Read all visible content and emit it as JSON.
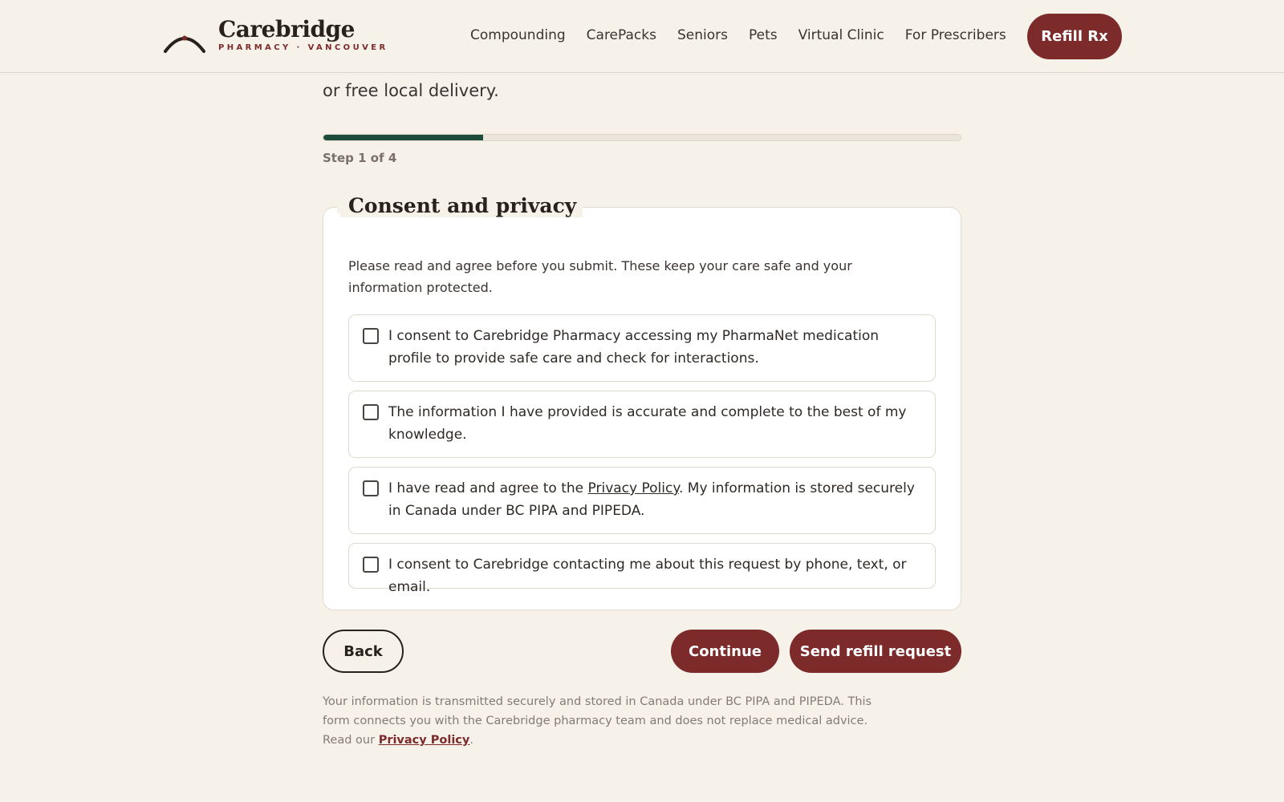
{
  "brand": {
    "name": "Carebridge",
    "tagline": "PHARMACY · VANCOUVER",
    "accent_color": "#7c2a2a",
    "progress_color": "#1d4c3b"
  },
  "nav": {
    "items": [
      {
        "label": "Compounding"
      },
      {
        "label": "CarePacks"
      },
      {
        "label": "Seniors"
      },
      {
        "label": "Pets"
      },
      {
        "label": "Virtual Clinic"
      },
      {
        "label": "For Prescribers"
      }
    ],
    "cta_label": "Refill Rx"
  },
  "intro": {
    "tail_text": "or free local delivery."
  },
  "progress": {
    "fraction": 0.25,
    "step_label": "Step 1 of 4"
  },
  "consent_section": {
    "title": "Consent and privacy",
    "description": "Please read and agree before you submit. These keep your care safe and your information protected.",
    "items": [
      {
        "text": "I consent to Carebridge Pharmacy accessing my PharmaNet medication profile to provide safe care and check for interactions.",
        "checked": false
      },
      {
        "text": "The information I have provided is accurate and complete to the best of my knowledge.",
        "checked": false
      },
      {
        "text_before": "I have read and agree to the ",
        "link_text": "Privacy Policy",
        "text_after": ". My information is stored securely in Canada under BC PIPA and PIPEDA.",
        "checked": false
      },
      {
        "text": "I consent to Carebridge contacting me about this request by phone, text, or email.",
        "checked": false
      }
    ]
  },
  "actions": {
    "back_label": "Back",
    "continue_label": "Continue",
    "send_label": "Send refill request"
  },
  "footnote": {
    "text": "Your information is transmitted securely and stored in Canada under BC PIPA and PIPEDA. This form connects you with the Carebridge pharmacy team and does not replace medical advice. Read our ",
    "link_text": "Privacy Policy",
    "end": "."
  }
}
